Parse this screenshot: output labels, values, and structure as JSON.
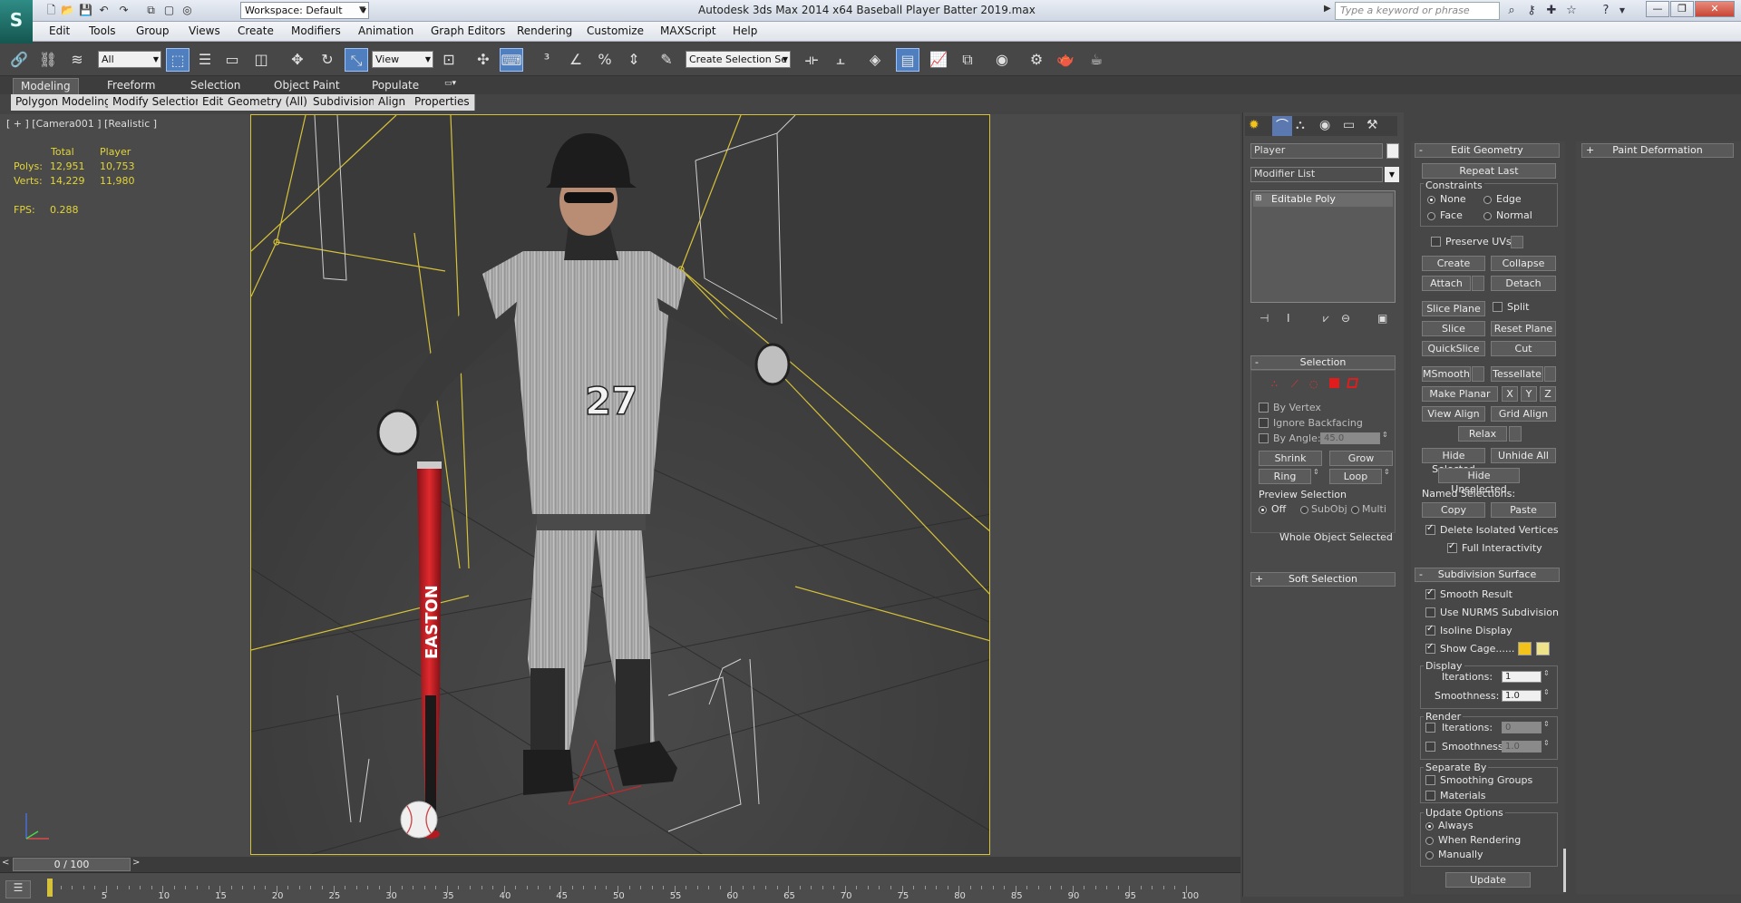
{
  "app": {
    "title": "Autodesk 3ds Max  2014 x64      Baseball Player Batter 2019.max",
    "logo": "S",
    "workspace": "Workspace: Default",
    "search_placeholder": "Type a keyword or phrase"
  },
  "menu": [
    "Edit",
    "Tools",
    "Group",
    "Views",
    "Create",
    "Modifiers",
    "Animation",
    "Graph Editors",
    "Rendering",
    "Customize",
    "MAXScript",
    "Help"
  ],
  "toolbar": {
    "selection_filter": "All",
    "coord_system": "View",
    "selection_set_placeholder": "Create Selection Se"
  },
  "ribbon": {
    "tabs": [
      "Modeling",
      "Freeform",
      "Selection",
      "Object Paint",
      "Populate"
    ],
    "subtabs": [
      "Polygon Modeling",
      "Modify Selection",
      "Edit",
      "Geometry (All)",
      "Subdivision",
      "Align",
      "Properties"
    ]
  },
  "viewport": {
    "label": "[ + ] [Camera001 ] [Realistic ]",
    "stats": {
      "col_total": "Total",
      "col_player": "Player",
      "polys_label": "Polys:",
      "polys_total": "12,951",
      "polys_player": "10,753",
      "verts_label": "Verts:",
      "verts_total": "14,229",
      "verts_player": "11,980",
      "fps_label": "FPS:",
      "fps_value": "0.288"
    },
    "bat_brand": "EASTON",
    "jersey_number": "27"
  },
  "timeline": {
    "frame_display": "0 / 100",
    "ticks": [
      "5",
      "10",
      "15",
      "20",
      "25",
      "30",
      "35",
      "40",
      "45",
      "50",
      "55",
      "60",
      "65",
      "70",
      "75",
      "80",
      "85",
      "90",
      "95",
      "100"
    ]
  },
  "command_panel": {
    "object_name": "Player",
    "modifier_list": "Modifier List",
    "stack_item": "Editable Poly",
    "selection": {
      "title": "Selection",
      "by_vertex": "By Vertex",
      "ignore_backfacing": "Ignore Backfacing",
      "by_angle": "By Angle:",
      "angle_value": "45.0",
      "shrink": "Shrink",
      "grow": "Grow",
      "ring": "Ring",
      "loop": "Loop",
      "preview_selection": "Preview Selection",
      "preview_off": "Off",
      "preview_subobj": "SubObj",
      "preview_multi": "Multi",
      "status": "Whole Object Selected"
    },
    "soft_selection": "Soft Selection",
    "edit_geometry": {
      "title": "Edit Geometry",
      "repeat_last": "Repeat Last",
      "constraints": "Constraints",
      "c_none": "None",
      "c_edge": "Edge",
      "c_face": "Face",
      "c_normal": "Normal",
      "preserve_uvs": "Preserve UVs",
      "create": "Create",
      "collapse": "Collapse",
      "attach": "Attach",
      "detach": "Detach",
      "slice_plane": "Slice Plane",
      "split": "Split",
      "slice": "Slice",
      "reset_plane": "Reset Plane",
      "quickslice": "QuickSlice",
      "cut": "Cut",
      "msmooth": "MSmooth",
      "tessellate": "Tessellate",
      "make_planar": "Make Planar",
      "x": "X",
      "y": "Y",
      "z": "Z",
      "view_align": "View Align",
      "grid_align": "Grid Align",
      "relax": "Relax",
      "hide_selected": "Hide Selected",
      "unhide_all": "Unhide All",
      "hide_unselected": "Hide Unselected",
      "named_selections": "Named Selections:",
      "copy": "Copy",
      "paste": "Paste",
      "delete_isolated": "Delete Isolated Vertices",
      "full_interactivity": "Full Interactivity"
    },
    "subdivision_surface": {
      "title": "Subdivision Surface",
      "smooth_result": "Smooth Result",
      "use_nurms": "Use NURMS Subdivision",
      "isoline_display": "Isoline Display",
      "show_cage": "Show Cage......",
      "cage_color_1": "#f2c31a",
      "cage_color_2": "#eee38a",
      "display": "Display",
      "iterations": "Iterations:",
      "display_iterations": "1",
      "smoothness": "Smoothness:",
      "display_smoothness": "1.0",
      "render": "Render",
      "render_iterations": "0",
      "render_smoothness": "1.0",
      "separate_by": "Separate By",
      "smoothing_groups": "Smoothing Groups",
      "materials": "Materials",
      "update_options": "Update Options",
      "always": "Always",
      "when_rendering": "When Rendering",
      "manually": "Manually",
      "update": "Update"
    },
    "paint_deformation": "Paint Deformation"
  },
  "colors": {
    "camera_frame": "#d6c239",
    "stats_text": "#e3d534",
    "active_button": "#4f7fbf"
  }
}
